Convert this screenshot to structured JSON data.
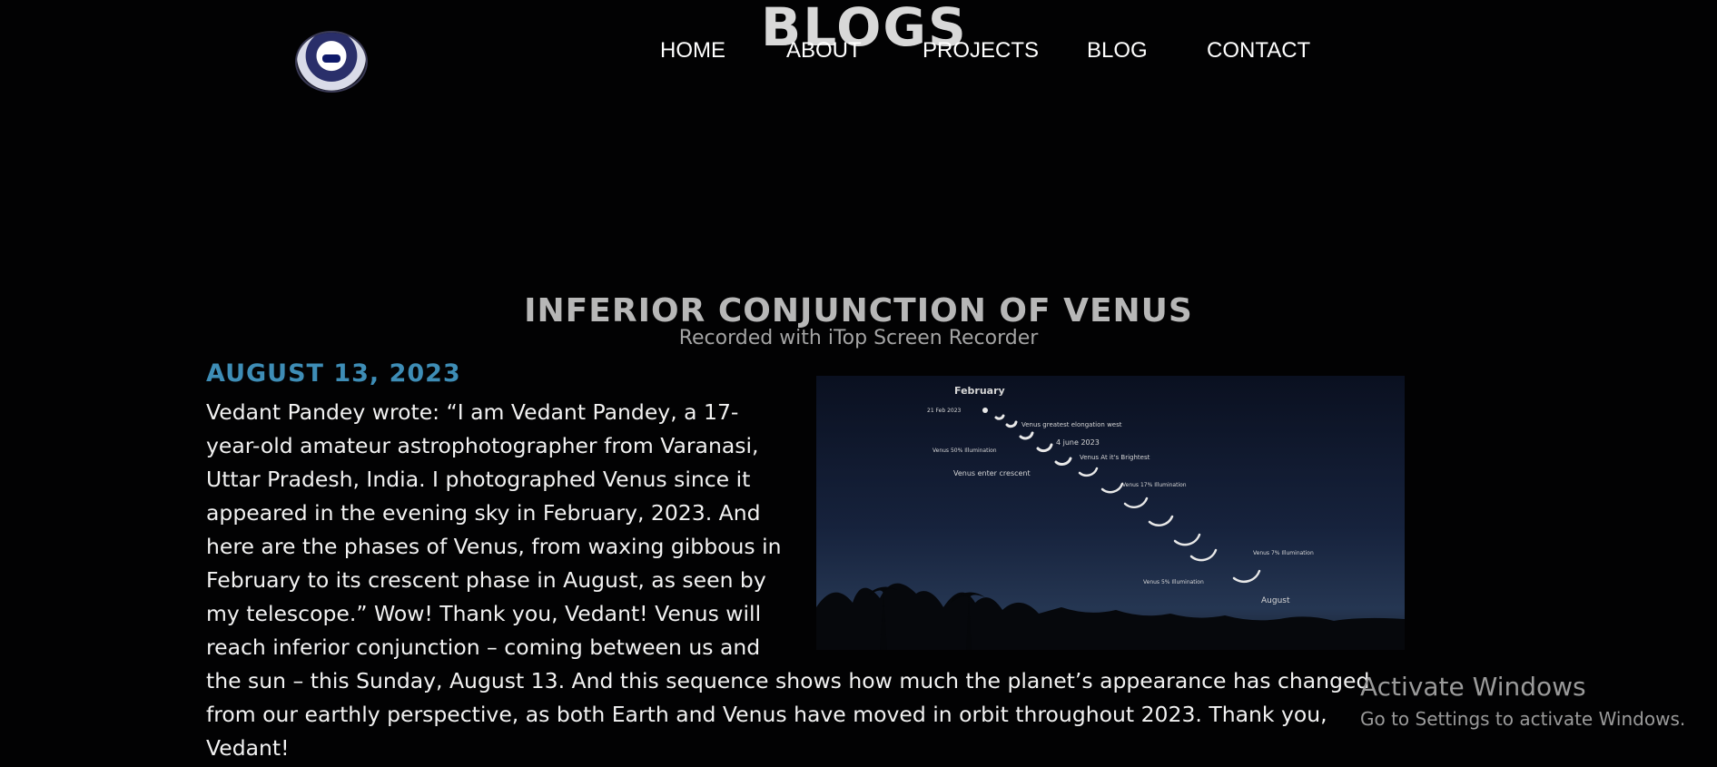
{
  "header": {
    "banner_word": "BLOGS",
    "nav": [
      "HOME",
      "ABOUT",
      "PROJECTS",
      "BLOG",
      "CONTACT"
    ]
  },
  "post": {
    "title": "INFERIOR CONJUNCTION OF VENUS",
    "overlay_caption": "Recorded with iTop Screen Recorder",
    "date": "AUGUST 13, 2023",
    "body": "Vedant Pandey wrote: “I am Vedant Pandey, a 17-year-old amateur astrophotographer from Varanasi, Uttar Pradesh, India. I photographed Venus since it appeared in the evening sky in February, 2023. And here are the phases of Venus, from waxing gibbous in February to its crescent phase in August, as seen by my telescope.” Wow! Thank you, Vedant! Venus will reach inferior conjunction – coming between us and the sun – this Sunday, August 13. And this sequence shows how much the planet’s appearance has changed from our earthly perspective, as both Earth and Venus have moved in orbit throughout 2023. Thank you, Vedant!",
    "image_labels": {
      "start_month": "February",
      "start_date": "21 Feb 2023",
      "elongation": "Venus greatest elongation west",
      "june": "4 june 2023",
      "fifty": "Venus 50% Illumination",
      "brightest": "Venus At it's Brightest",
      "crescent": "Venus enter crescent",
      "seventeen": "Venus 17% Illumination",
      "seven": "Venus 7% Illumination",
      "five": "Venus 5% Illumination",
      "end_month": "August"
    }
  },
  "os_notice": {
    "title": "Activate Windows",
    "subtitle": "Go to Settings to activate Windows."
  },
  "colors": {
    "background": "#020203",
    "date_accent": "#3e8db6",
    "title_gray": "#b7b7b7"
  },
  "icons": {
    "logo": "astronaut-helmet-logo"
  }
}
